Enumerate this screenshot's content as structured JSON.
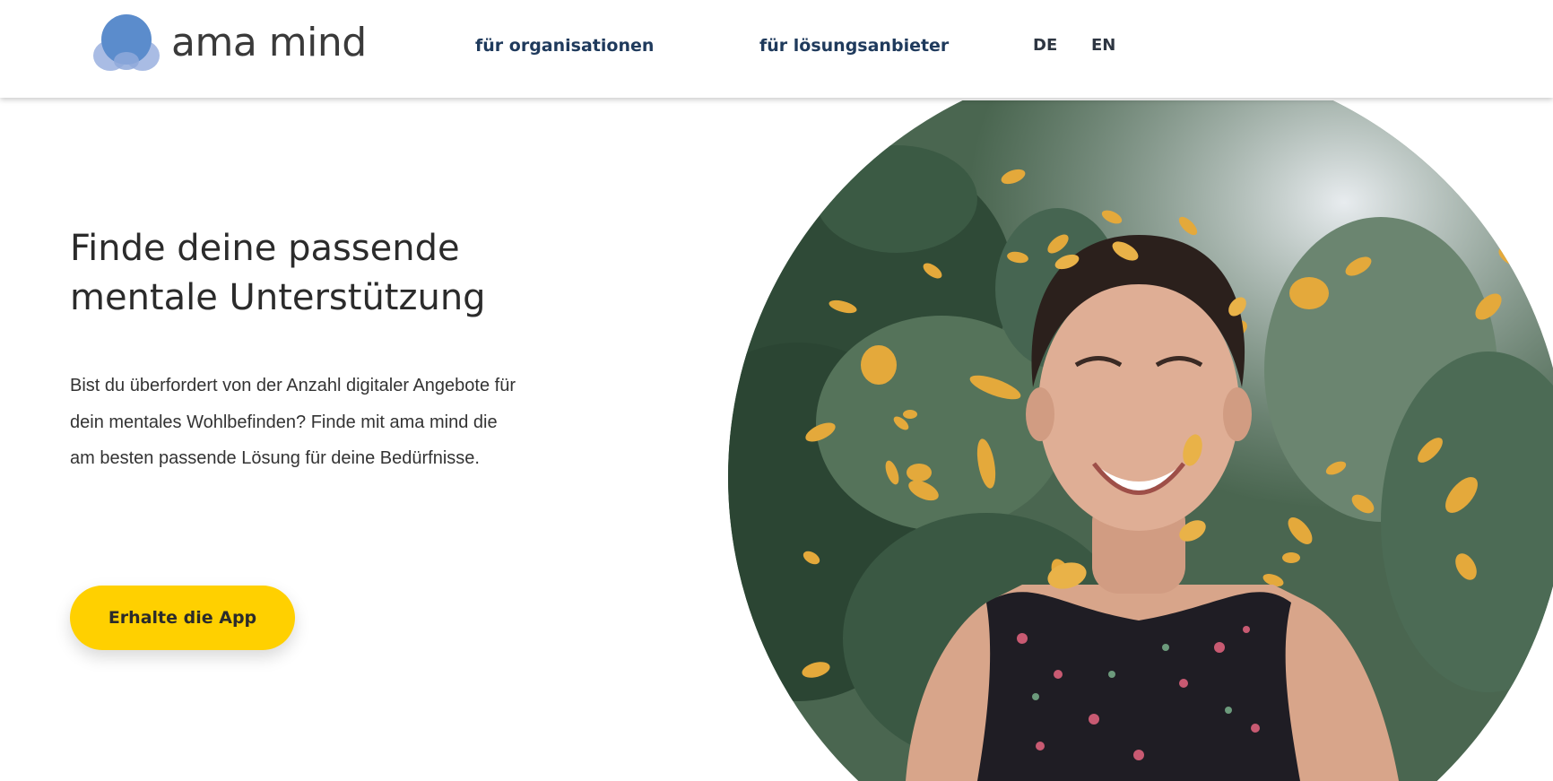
{
  "header": {
    "logo_text": "ama mind",
    "nav": [
      {
        "label": "für organisationen"
      },
      {
        "label": "für lösungsanbieter"
      }
    ],
    "languages": [
      {
        "label": "DE"
      },
      {
        "label": "EN"
      }
    ]
  },
  "hero": {
    "headline_line1": "Finde deine passende",
    "headline_line2": "mentale Unterstützung",
    "intro": "Bist du überfordert von der Anzahl digitaler Angebote für dein mentales Wohlbefinden? Finde mit ama mind die am besten passende Lösung für deine Bedürfnisse.",
    "cta_label": "Erhalte die App"
  },
  "colors": {
    "accent": "#ffd000",
    "nav_text": "#1f3a5c",
    "logo_blue": "#5b8ccc",
    "logo_light": "#a9bce4"
  }
}
